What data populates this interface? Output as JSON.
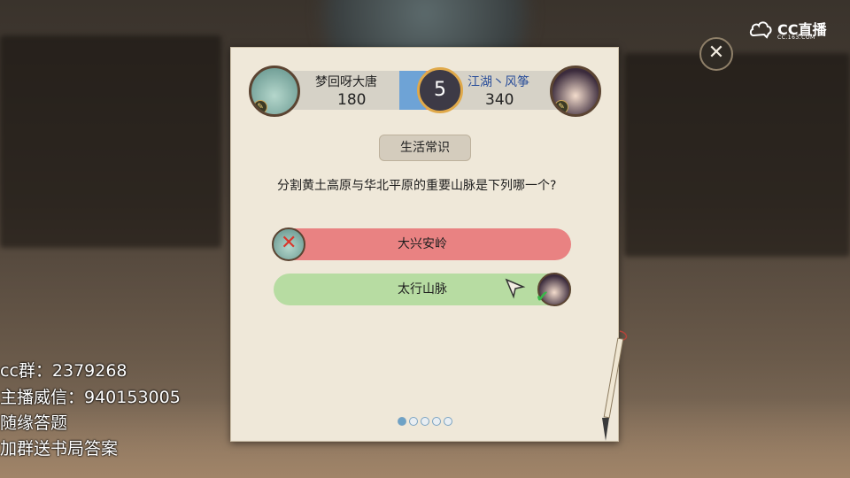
{
  "player_left": {
    "name": "梦回呀大唐",
    "score": "180"
  },
  "player_right": {
    "name": "江湖丶风筝",
    "score": "340"
  },
  "timer": "5",
  "category": "生活常识",
  "question": "分割黄土高原与华北平原的重要山脉是下列哪一个?",
  "answers": [
    {
      "text": "大兴安岭",
      "state": "wrong"
    },
    {
      "text": "太行山脉",
      "state": "correct"
    }
  ],
  "pagination": {
    "total": 5,
    "current": 1
  },
  "logo": {
    "main": "CC直播",
    "sub": "CC.163.COM"
  },
  "overlay": {
    "line1": "cc群：2379268",
    "line2": "主播威信：940153005",
    "line3": "随缘答题",
    "line4": "加群送书局答案"
  },
  "colors": {
    "wrong": "#e98282",
    "correct": "#b7dca2",
    "blue_side": "#6ea3d6",
    "red_side": "#e57c7c"
  },
  "icons": [
    "close-icon",
    "cross-mark-icon",
    "check-mark-icon",
    "cursor-arrow-icon",
    "brush-icon",
    "cc-logo-icon"
  ]
}
